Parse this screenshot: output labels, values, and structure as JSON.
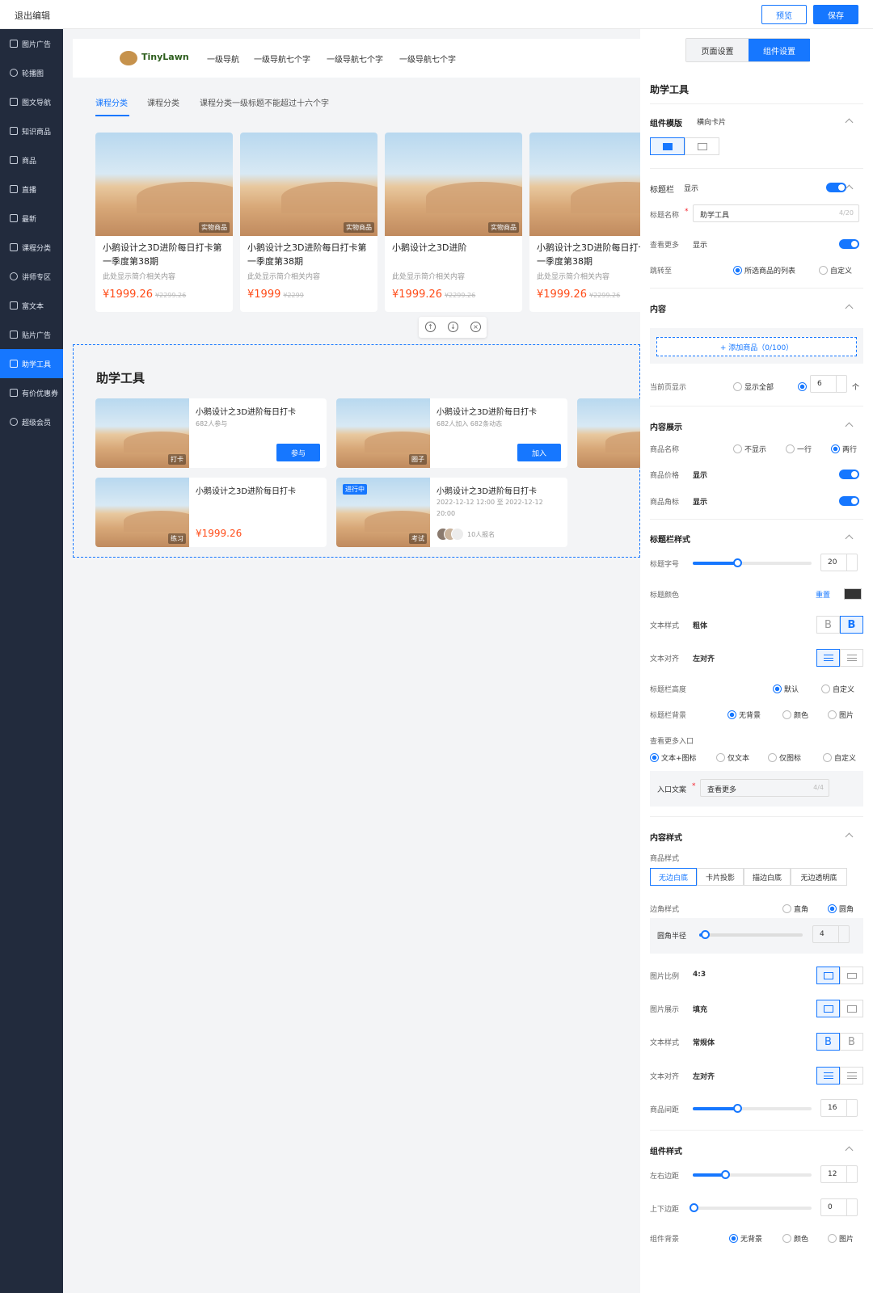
{
  "topbar": {
    "exit": "退出编辑",
    "preview": "预览",
    "save": "保存"
  },
  "sidebar": [
    "图片广告",
    "轮播图",
    "图文导航",
    "知识商品",
    "商品",
    "直播",
    "最新",
    "课程分类",
    "讲师专区",
    "富文本",
    "贴片广告",
    "助学工具",
    "有价优惠券",
    "超级会员"
  ],
  "nav": {
    "logo": "TinyLawn",
    "items": [
      "一级导航",
      "一级导航七个字",
      "一级导航七个字",
      "一级导航七个字"
    ]
  },
  "tabs": [
    "课程分类",
    "课程分类",
    "课程分类一级标题不能超过十六个字"
  ],
  "product_cards": [
    {
      "badge": "实物商品",
      "title": "小鹅设计之3D进阶每日打卡第一季度第38期",
      "desc": "此处显示简介相关内容",
      "price": "¥1999.26",
      "old": "¥2299.26"
    },
    {
      "badge": "实物商品",
      "title": "小鹅设计之3D进阶每日打卡第一季度第38期",
      "desc": "此处显示简介相关内容",
      "price": "¥1999",
      "old": "¥2299"
    },
    {
      "badge": "实物商品",
      "title": "小鹅设计之3D进阶",
      "desc": "此处显示简介相关内容",
      "price": "¥1999.26",
      "old": "¥2299.26"
    },
    {
      "badge": "",
      "title": "小鹅设计之3D进阶每日打卡第一季度第38期",
      "desc": "此处显示简介相关内容",
      "price": "¥1999.26",
      "old": "¥2299.26"
    }
  ],
  "ctrl": [
    "↑",
    "↓",
    "×"
  ],
  "section_title": "助学工具",
  "tool_cards": {
    "c1": {
      "badge": "打卡",
      "title": "小鹅设计之3D进阶每日打卡",
      "sub": "682人参与",
      "btn": "参与"
    },
    "c2": {
      "badge": "圈子",
      "title": "小鹅设计之3D进阶每日打卡",
      "sub": "682人加入  682条动态",
      "btn": "加入"
    },
    "c3": {
      "badge": "练习",
      "title": "小鹅设计之3D进阶每日打卡",
      "price": "¥1999.26"
    },
    "c4": {
      "badge": "考试",
      "live": "进行中",
      "title": "小鹅设计之3D进阶每日打卡",
      "sub": "2022-12-12 12:00 至 2022-12-12 20:00",
      "enroll": "10人报名"
    }
  },
  "panel": {
    "tab_page": "页面设置",
    "tab_component": "组件设置",
    "title": "助学工具",
    "template_label": "组件模版",
    "template_value": "横向卡片",
    "titlebar_label": "标题栏",
    "titlebar_value": "显示",
    "titlename_label": "标题名称",
    "titlename_value": "助学工具",
    "titlename_count": "4/20",
    "more_label": "查看更多",
    "more_value": "显示",
    "jump_label": "跳转至",
    "jump_opt1": "所选商品的列表",
    "jump_opt2": "自定义",
    "content_label": "内容",
    "add_btn": "+ 添加商品（0/100）",
    "page_show_label": "当前页显示",
    "page_show_all": "显示全部",
    "page_show_num": "6",
    "page_show_unit": "个",
    "display_label": "内容展示",
    "name_label": "商品名称",
    "name_opt1": "不显示",
    "name_opt2": "一行",
    "name_opt3": "两行",
    "price_label": "商品价格",
    "price_value": "显示",
    "corner_label": "商品角标",
    "corner_value": "显示",
    "tstyle_label": "标题栏样式",
    "fontsize_label": "标题字号",
    "fontsize_value": "20",
    "color_label": "标题颜色",
    "color_reset": "重置",
    "textstyle_label": "文本样式",
    "textstyle_value": "粗体",
    "align_label": "文本对齐",
    "align_value": "左对齐",
    "height_label": "标题栏高度",
    "height_opt1": "默认",
    "height_opt2": "自定义",
    "bg_label": "标题栏背景",
    "bg_opt1": "无背景",
    "bg_opt2": "颜色",
    "bg_opt3": "图片",
    "entry_label": "查看更多入口",
    "entry_opt1": "文本+图标",
    "entry_opt2": "仅文本",
    "entry_opt3": "仅图标",
    "entry_opt4": "自定义",
    "entry_text_label": "入口文案",
    "entry_text_value": "查看更多",
    "entry_text_count": "4/4",
    "cstyle_label": "内容样式",
    "goods_style_label": "商品样式",
    "goods_styles": [
      "无边白底",
      "卡片投影",
      "描边白底",
      "无边透明底"
    ],
    "edge_label": "边角样式",
    "edge_opt1": "直角",
    "edge_opt2": "圆角",
    "radius_label": "圆角半径",
    "radius_value": "4",
    "ratio_label": "图片比例",
    "ratio_value": "4:3",
    "imgshow_label": "图片展示",
    "imgshow_value": "填充",
    "textstyle2_label": "文本样式",
    "textstyle2_value": "常规体",
    "align2_label": "文本对齐",
    "align2_value": "左对齐",
    "gap_label": "商品间距",
    "gap_value": "16",
    "comp_label": "组件样式",
    "lr_label": "左右边距",
    "lr_value": "12",
    "tb_label": "上下边距",
    "tb_value": "0",
    "compbg_label": "组件背景",
    "compbg_opt1": "无背景",
    "compbg_opt2": "颜色",
    "compbg_opt3": "图片"
  },
  "colors": {
    "accent": "#1677ff",
    "price": "#ff4d1a",
    "sidebar": "#222b3d"
  }
}
